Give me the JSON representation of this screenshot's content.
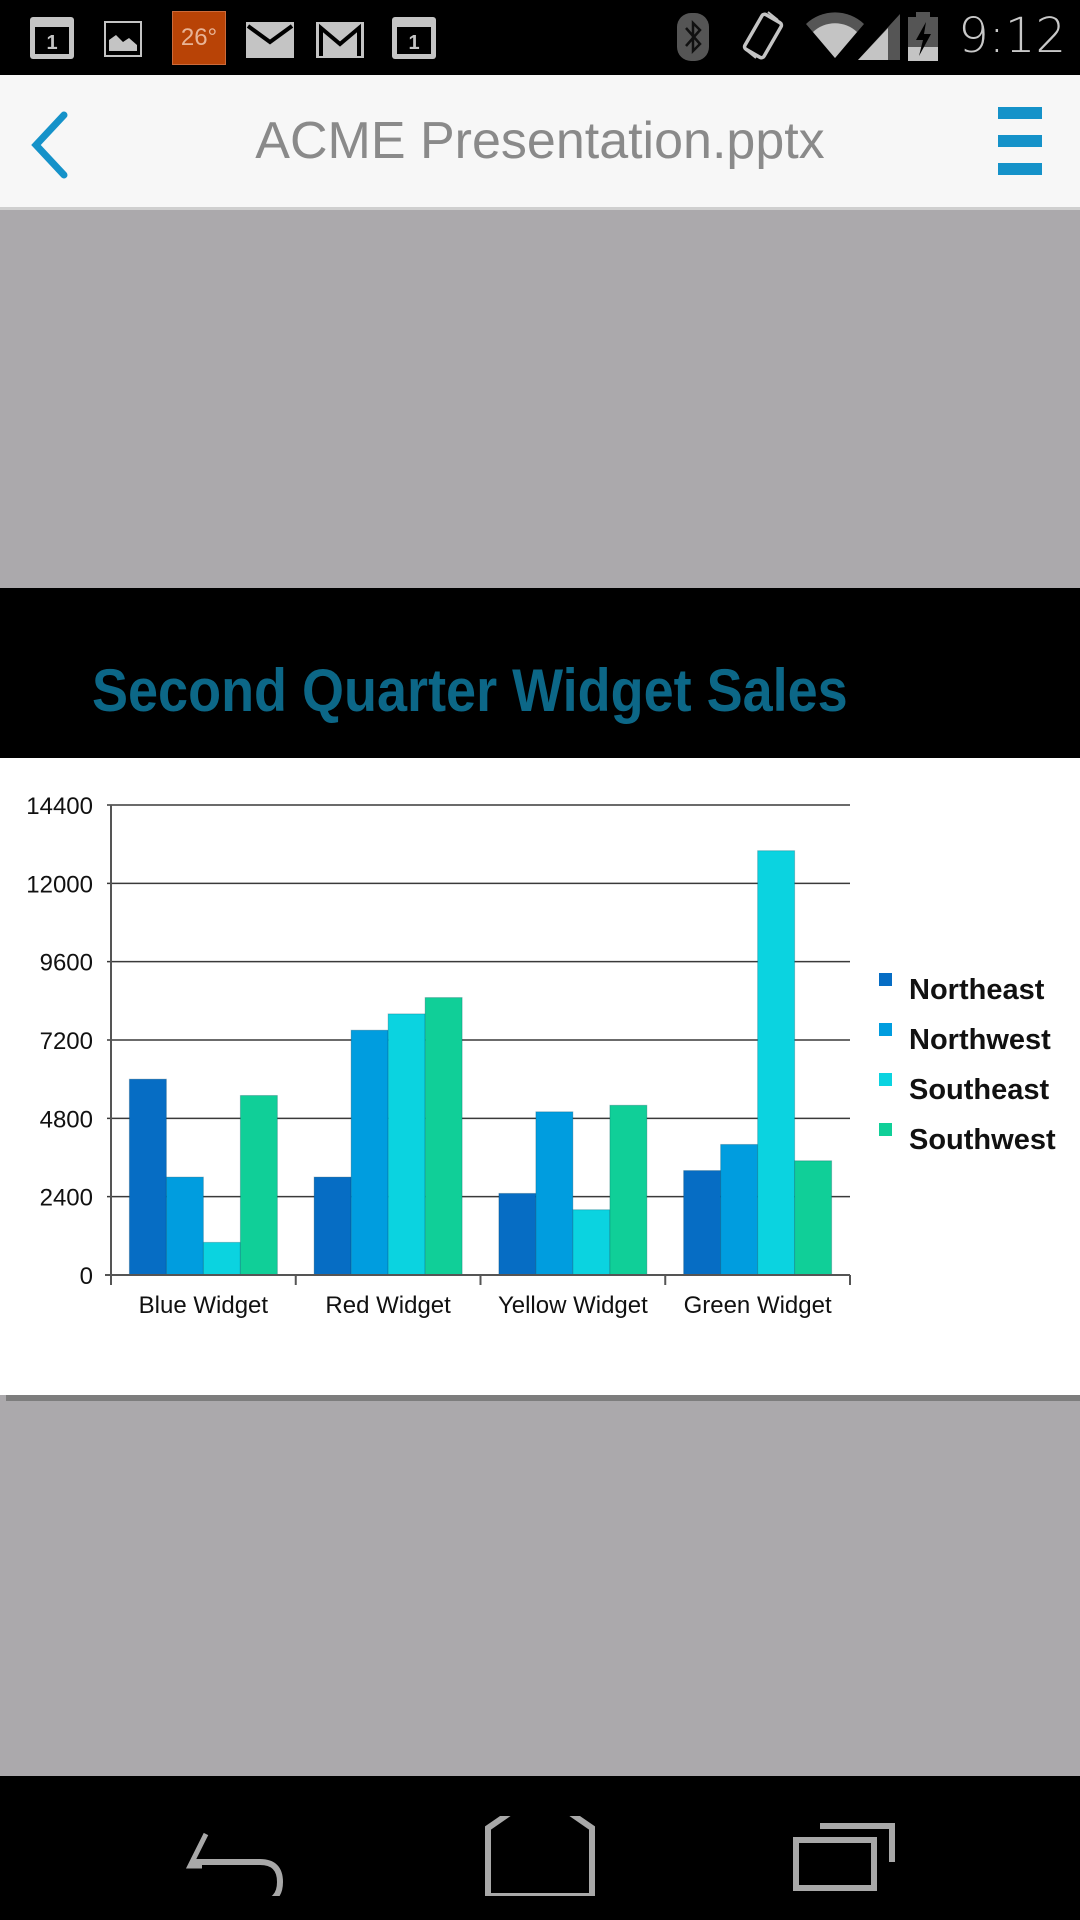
{
  "status_bar": {
    "time": "9:12",
    "weather_temp": "26°",
    "notification_icons": [
      "calendar-icon",
      "gallery-icon",
      "weather-icon",
      "email-icon",
      "gmail-icon",
      "calendar-icon"
    ],
    "calendar_day": "1",
    "system_icons": [
      "bluetooth-icon",
      "vibrate-icon",
      "wifi-icon",
      "signal-icon",
      "battery-charging-icon"
    ]
  },
  "app_bar": {
    "title": "ACME Presentation.pptx",
    "back_icon": "chevron-left-icon",
    "menu_icon": "hamburger-menu-icon",
    "accent": "#1592c9"
  },
  "slide": {
    "title": "Second Quarter Widget Sales",
    "title_color": "#0c6787"
  },
  "chart_data": {
    "type": "bar",
    "title": "Second Quarter Widget Sales",
    "xlabel": "",
    "ylabel": "",
    "categories": [
      "Blue Widget",
      "Red Widget",
      "Yellow Widget",
      "Green Widget"
    ],
    "series": [
      {
        "name": "Northeast",
        "color": "#066dc4",
        "values": [
          6000,
          3000,
          2500,
          3200
        ]
      },
      {
        "name": "Northwest",
        "color": "#009ddf",
        "values": [
          3000,
          7500,
          5000,
          4000
        ]
      },
      {
        "name": "Southeast",
        "color": "#0bd3e0",
        "values": [
          1000,
          8000,
          2000,
          13000
        ]
      },
      {
        "name": "Southwest",
        "color": "#10cf98",
        "values": [
          5500,
          8500,
          5200,
          3500
        ]
      }
    ],
    "yticks": [
      0,
      2400,
      4800,
      7200,
      9600,
      12000,
      14400
    ],
    "ytick_labels": [
      "0",
      "2400",
      "4800",
      "7200",
      "9600",
      "12000",
      "14400"
    ],
    "ylim": [
      0,
      14400
    ],
    "grid": true,
    "legend": "right"
  },
  "nav_bar": {
    "buttons": [
      "back-icon",
      "home-icon",
      "recent-apps-icon"
    ]
  }
}
